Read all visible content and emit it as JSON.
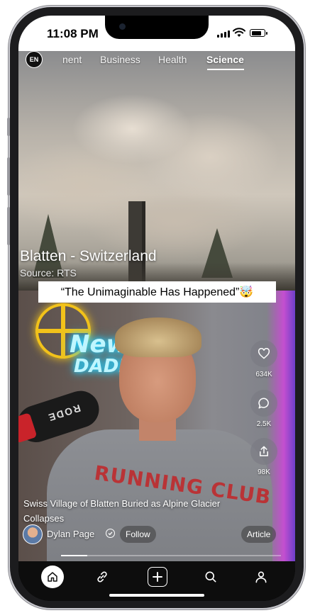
{
  "status_bar": {
    "time": "11:08 PM",
    "battery_level": 0.85
  },
  "header": {
    "language_badge": "EN",
    "tabs": [
      {
        "label": "nent",
        "active": false
      },
      {
        "label": "Business",
        "active": false
      },
      {
        "label": "Health",
        "active": false
      },
      {
        "label": "Science",
        "active": true
      }
    ]
  },
  "top_video": {
    "location_caption": "Blatten - Switzerland",
    "source_caption": "Source: RTS"
  },
  "banner": {
    "quote": "“The Unimaginable Has Happened”🤯"
  },
  "bottom_video": {
    "neon_sign_line1": "New",
    "neon_sign_line2": "DADD",
    "mic_brand": "RODE",
    "shirt_text": "RUNNING CLUB"
  },
  "actions": {
    "likes": "634K",
    "comments": "2.5K",
    "shares": "98K"
  },
  "story": {
    "headline": "Swiss Village of Blatten Buried as Alpine Glacier Collapses",
    "author": "Dylan Page",
    "follow_label": "Follow",
    "article_label": "Article",
    "progress": 0.12
  },
  "bottom_nav": {
    "items": [
      "home-icon",
      "link-icon",
      "plus-icon",
      "search-icon",
      "profile-icon"
    ],
    "active": "home-icon"
  },
  "colors": {
    "accent_white": "#ffffff",
    "nav_background": "#0d0d0d",
    "neon_yellow": "#f2c21a",
    "neon_cyan": "#25d0ff"
  }
}
